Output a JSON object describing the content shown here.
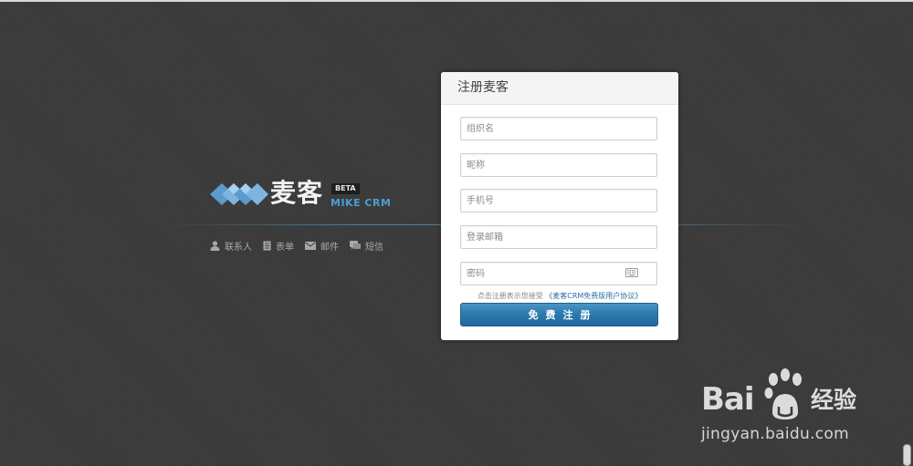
{
  "logo": {
    "name_cn": "麦客",
    "badge": "BETA",
    "name_en": "MIKE CRM"
  },
  "features": [
    {
      "label": "联系人",
      "icon": "person-icon"
    },
    {
      "label": "表单",
      "icon": "form-icon"
    },
    {
      "label": "邮件",
      "icon": "mail-icon"
    },
    {
      "label": "短信",
      "icon": "sms-icon"
    }
  ],
  "register": {
    "title": "注册麦客",
    "org_placeholder": "组织名",
    "nickname_placeholder": "昵称",
    "phone_placeholder": "手机号",
    "email_placeholder": "登录邮箱",
    "password_placeholder": "密码",
    "keyboard_icon": "keyboard-icon",
    "agreement_prefix": "点击注册表示您接受",
    "agreement_link": "《麦客CRM免费版用户协议》",
    "submit_label": "免费注册"
  },
  "watermark": {
    "brand": "Bai",
    "brand_tail": "经验",
    "url": "jingyan.baidu.com"
  },
  "colors": {
    "background": "#3b3b3b",
    "accent": "#2a79ad",
    "logo_blue": "#4a9ed3"
  }
}
